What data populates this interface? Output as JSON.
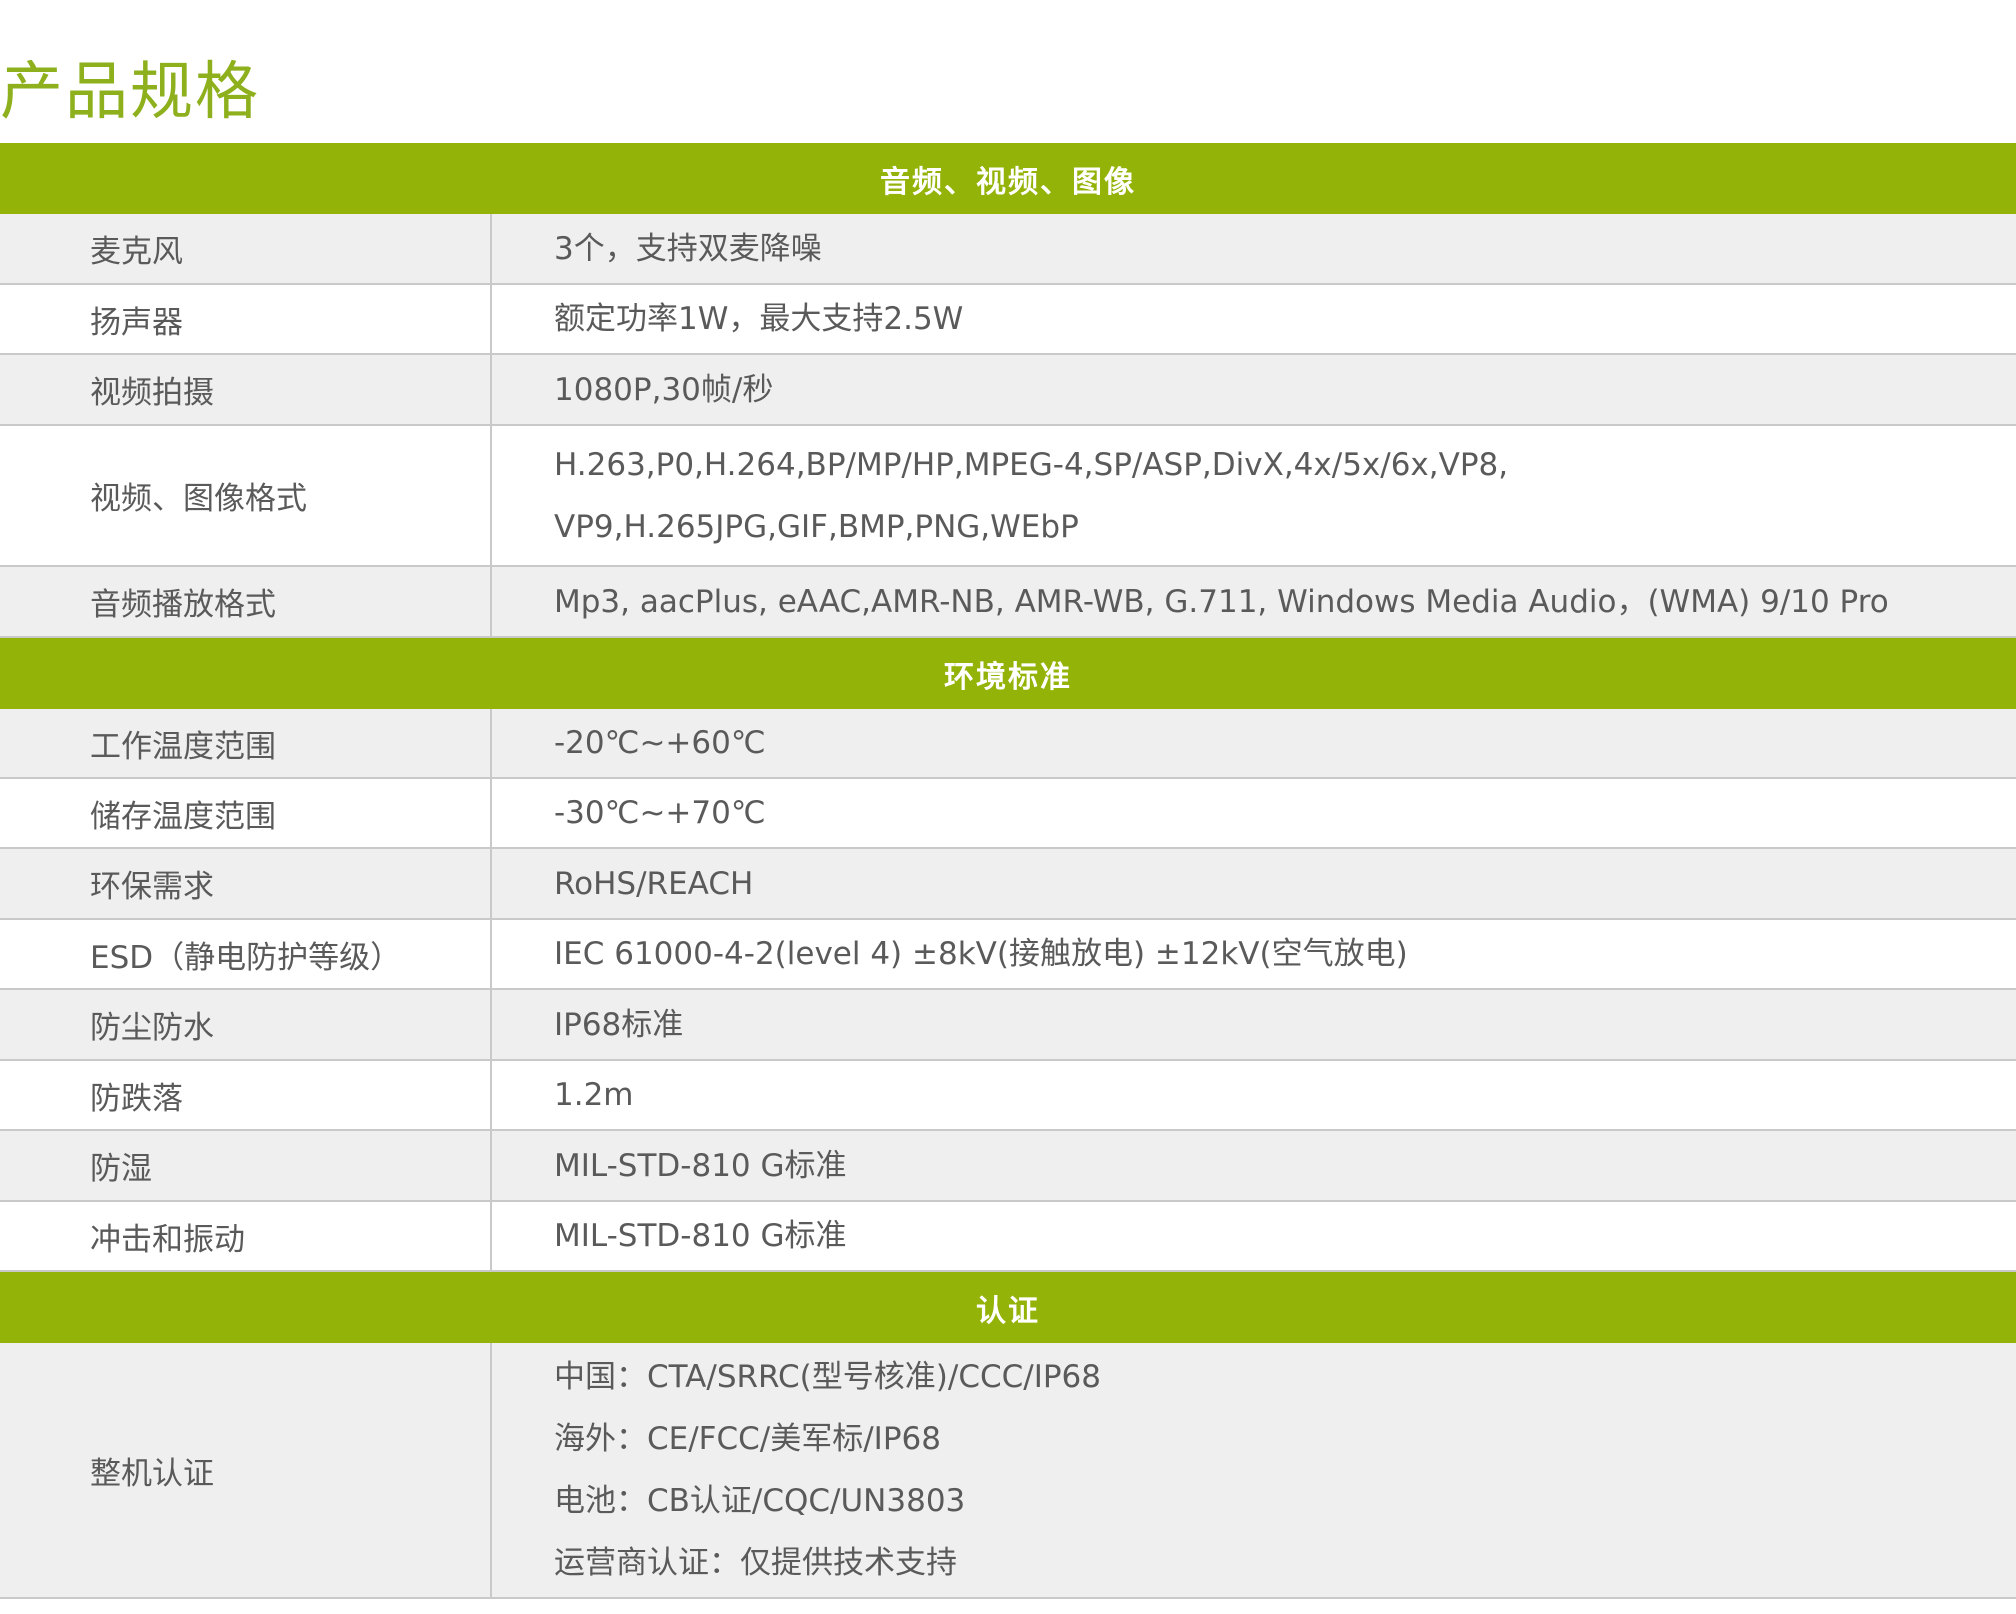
{
  "page": {
    "title": "产品规格"
  },
  "sections": [
    {
      "header": "音频、视频、图像",
      "rows": [
        {
          "label": "麦克风",
          "values": [
            "3个，支持双麦降噪"
          ]
        },
        {
          "label": "扬声器",
          "values": [
            "额定功率1W，最大支持2.5W"
          ]
        },
        {
          "label": "视频拍摄",
          "values": [
            "1080P,30帧/秒"
          ]
        },
        {
          "label": "视频、图像格式",
          "values": [
            "H.263,P0,H.264,BP/MP/HP,MPEG-4,SP/ASP,DivX,4x/5x/6x,VP8,",
            "VP9,H.265JPG,GIF,BMP,PNG,WEbP"
          ]
        },
        {
          "label": "音频播放格式",
          "values": [
            "Mp3, aacPlus, eAAC,AMR-NB, AMR-WB, G.711, Windows Media Audio，(WMA) 9/10 Pro"
          ]
        }
      ]
    },
    {
      "header": "环境标准",
      "rows": [
        {
          "label": "工作温度范围",
          "values": [
            "-20℃~+60℃"
          ]
        },
        {
          "label": "储存温度范围",
          "values": [
            "-30℃~+70℃"
          ]
        },
        {
          "label": "环保需求",
          "values": [
            "RoHS/REACH"
          ]
        },
        {
          "label": "ESD（静电防护等级）",
          "values": [
            "IEC 61000-4-2(level 4) ±8kV(接触放电) ±12kV(空气放电)"
          ]
        },
        {
          "label": "防尘防水",
          "values": [
            "IP68标准"
          ]
        },
        {
          "label": "防跌落",
          "values": [
            "1.2m"
          ]
        },
        {
          "label": "防湿",
          "values": [
            "MIL-STD-810 G标准"
          ]
        },
        {
          "label": "冲击和振动",
          "values": [
            "MIL-STD-810 G标准"
          ]
        }
      ]
    },
    {
      "header": "认证",
      "rows": [
        {
          "label": "整机认证",
          "values": [
            "中国：CTA/SRRC(型号核准)/CCC/IP68",
            "海外：CE/FCC/美军标/IP68",
            "电池：CB认证/CQC/UN3803",
            "运营商认证：仅提供技术支持"
          ]
        }
      ]
    }
  ],
  "colors": {
    "accent_green": "#94b308",
    "title_green": "#8db01c",
    "row_shade": "#efefef",
    "divider": "#c9c9c9",
    "text": "#5a5a5a"
  }
}
